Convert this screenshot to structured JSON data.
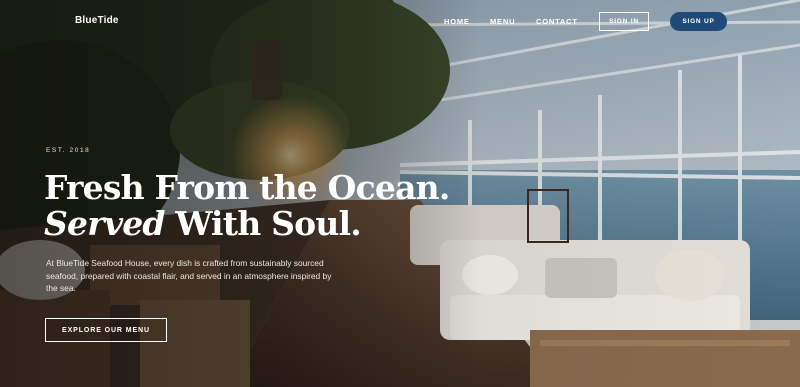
{
  "brand": {
    "logo": "BlueTide"
  },
  "nav": {
    "links": [
      "HOME",
      "MENU",
      "CONTACT"
    ],
    "sign_in": "SIGN IN",
    "sign_up": "SIGN UP"
  },
  "hero": {
    "eyebrow": "EST. 2018",
    "headline_line1": "Fresh From the Ocean.",
    "headline_em": "Served",
    "headline_line2_rest": " With Soul.",
    "description": "At BlueTide Seafood House, every dish is crafted from sustainably sourced seafood, prepared with coastal flair, and served in an atmosphere inspired by the sea.",
    "cta": "EXPLORE OUR MENU"
  },
  "colors": {
    "accent": "#1f4a78",
    "text": "#ffffff"
  }
}
